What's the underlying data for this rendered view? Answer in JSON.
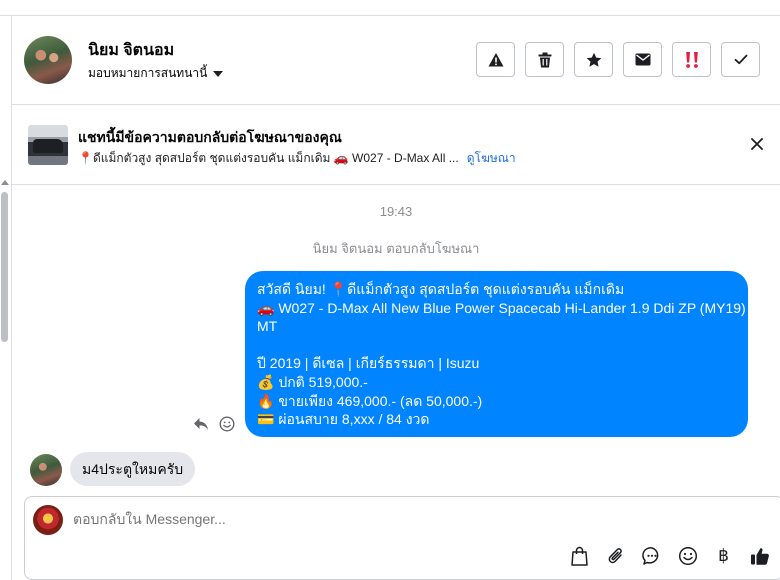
{
  "contact": {
    "name": "นิยม จิตนอม",
    "assign_label": "มอบหมายการสนทนานี้"
  },
  "header_actions": [
    {
      "name": "report-button",
      "icon": "warning-icon"
    },
    {
      "name": "delete-button",
      "icon": "trash-icon"
    },
    {
      "name": "star-button",
      "icon": "star-icon"
    },
    {
      "name": "mark-unread-button",
      "icon": "envelope-icon"
    },
    {
      "name": "follow-up-button",
      "icon": "exclamation-icon"
    },
    {
      "name": "mark-done-button",
      "icon": "check-icon"
    }
  ],
  "ad_banner": {
    "title": "แชทนี้มีข้อความตอบกลับต่อโฆษณาของคุณ",
    "subtitle": "📍ดีแม็กตัวสูง สุดสปอร์ต ชุดแต่งรอบคัน แม็กเดิม 🚗 W027 - D-Max All ...",
    "link": "ดูโฆษณา"
  },
  "conversation": {
    "timestamp": "19:43",
    "reply_note": "นิยม จิตนอม ตอบกลับโฆษณา",
    "outgoing_message_lines": [
      "สวัสดี นิยม! 📍ดีแม็กตัวสูง สุดสปอร์ต ชุดแต่งรอบคัน แม็กเดิม",
      "🚗 W027 - D-Max All New Blue Power Spacecab Hi-Lander 1.9 Ddi ZP (MY19)",
      "MT",
      "",
      "ปี 2019 | ดีเซล | เกียร์ธรรมดา | Isuzu",
      "💰 ปกติ 519,000.-",
      "🔥 ขายเพียง 469,000.- (ลด 50,000.-)",
      "💳 ผ่อนสบาย 8,xxx / 84 งวด"
    ],
    "incoming_message": "ม4ประตูใหมครับ"
  },
  "composer": {
    "placeholder": "ตอบกลับใน Messenger..."
  },
  "colors": {
    "accent": "#0084ff",
    "link": "#216fdb",
    "incoming_bubble": "#e4e6eb",
    "follow_up_red": "#e41e3f"
  }
}
